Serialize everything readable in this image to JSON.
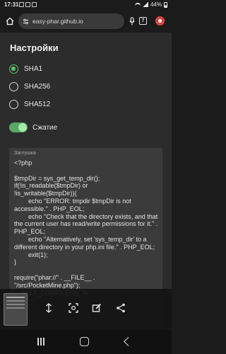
{
  "status_bar": {
    "time": "17:31",
    "battery": "44%"
  },
  "browser": {
    "url": "easy-phar.github.io",
    "tab_count": "7"
  },
  "page": {
    "title": "Настройки",
    "hash_options": [
      {
        "label": "SHA1",
        "checked": true
      },
      {
        "label": "SHA256",
        "checked": false
      },
      {
        "label": "SHA512",
        "checked": false
      }
    ],
    "compression": {
      "label": "Сжатие",
      "enabled": true
    },
    "stub": {
      "caption": "Заглушка",
      "code": "<?php\n\n$tmpDir = sys_get_temp_dir();\nif(!is_readable($tmpDir) or\n!is_writable($tmpDir)){\n        echo \"ERROR: tmpdir $tmpDir is not accessible.\" . PHP_EOL;\n        echo \"Check that the directory exists, and that the current user has read/write permissions for it.\" . PHP_EOL;\n        echo \"Alternatively, set 'sys_temp_dir' to a different directory in your php.ini file.\" . PHP_EOL;\n        exit(1);\n}\n\nrequire(\"phar://\" . __FILE__ .\n\"/src/PocketMine.php\");\n__HALT_COMPILER(); ?>"
    }
  },
  "colors": {
    "accent": "#5fbf6a",
    "page_bg": "#2c2c2c",
    "code_bg": "#3b3b3b"
  }
}
